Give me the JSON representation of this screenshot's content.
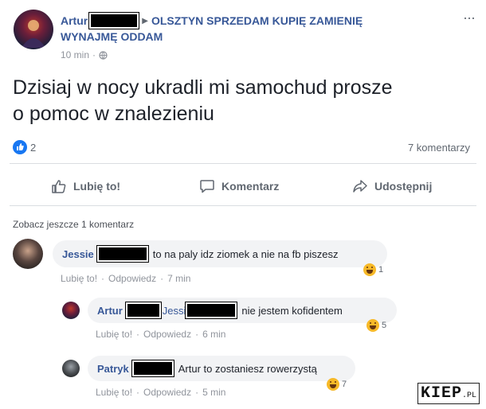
{
  "post": {
    "author": "Artur",
    "group": "OLSZTYN SPRZEDAM KUPIĘ ZAMIENIĘ",
    "group_line2": "WYNAJMĘ ODDAM",
    "time": "10 min",
    "time_sep": "·",
    "text_line1": "Dzisiaj w nocy ukradli mi samochud prosze",
    "text_line2": "o pomoc w znalezieniu",
    "like_count": "2",
    "comments_count": "7 komentarzy",
    "more": "···"
  },
  "actions": {
    "like": "Lubię to!",
    "comment": "Komentarz",
    "share": "Udostępnij"
  },
  "comments_header": "Zobacz jeszcze 1 komentarz",
  "comments": [
    {
      "name": "Jessie",
      "text": "to na paly idz ziomek a nie na fb piszesz",
      "like": "Lubię to!",
      "reply": "Odpowiedz",
      "time": "7 min",
      "reactions": "1"
    },
    {
      "name": "Artur",
      "mention": "Jessi",
      "text": "nie jestem kofidentem",
      "like": "Lubię to!",
      "reply": "Odpowiedz",
      "time": "6 min",
      "reactions": "5"
    },
    {
      "name": "Patryk",
      "text": "Artur to zostaniesz rowerzystą",
      "like": "Lubię to!",
      "reply": "Odpowiedz",
      "time": "5 min",
      "reactions": "7"
    }
  ],
  "watermark": {
    "main": "KIEP",
    "suffix": ".PL"
  },
  "colors": {
    "link": "#385898",
    "meta": "#90949c",
    "bubble": "#f2f3f5",
    "like_blue": "#1877f2"
  }
}
